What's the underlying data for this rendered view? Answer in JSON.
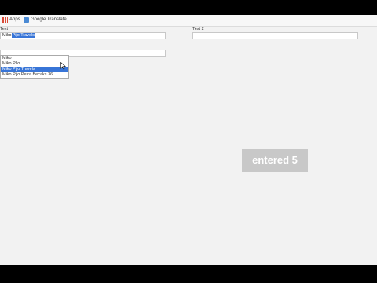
{
  "bookmarks": [
    {
      "label": "Apps",
      "icon": "apps-icon"
    },
    {
      "label": "Google Translate",
      "icon": "google-translate-icon"
    }
  ],
  "form": {
    "label1": "Text",
    "label2": "Text 2",
    "input1_typed": "Miko",
    "input1_selected": "Pijo Travels",
    "input2_value": "",
    "input3_value": ""
  },
  "dropdown": {
    "options": [
      "Miko",
      "Miko Pilo",
      "Miko Pijo Travels",
      "Miko Pijo Petra Becaks 36"
    ],
    "active_index": 2
  },
  "toast": {
    "text": "entered 5"
  }
}
